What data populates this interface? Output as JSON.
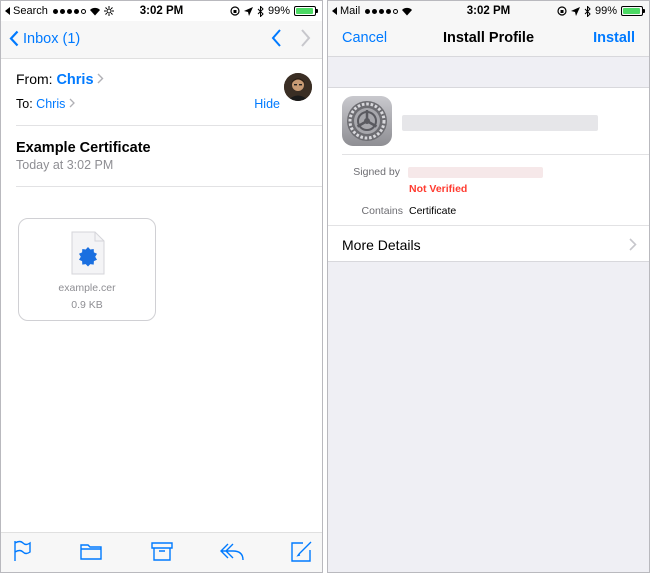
{
  "left": {
    "status": {
      "carrier": "Search",
      "time": "3:02 PM",
      "battery": "99%",
      "battery_fraction": 0.99
    },
    "nav": {
      "back_label": "Inbox (1)"
    },
    "from_label": "From:",
    "from_name": "Chris",
    "to_label": "To:",
    "to_name": "Chris",
    "hide_label": "Hide",
    "subject": "Example Certificate",
    "date": "Today at 3:02 PM",
    "attachment": {
      "filename": "example.cer",
      "size": "0.9 KB"
    },
    "toolbar": [
      "flag-icon",
      "folder-icon",
      "archive-icon",
      "reply-icon",
      "compose-icon"
    ]
  },
  "right": {
    "status": {
      "carrier": "Mail",
      "time": "3:02 PM",
      "battery": "99%",
      "battery_fraction": 0.99
    },
    "nav": {
      "cancel": "Cancel",
      "title": "Install Profile",
      "install": "Install"
    },
    "signed_by_label": "Signed by",
    "signed_by_status": "Not Verified",
    "contains_label": "Contains",
    "contains_value": "Certificate",
    "more_details": "More Details"
  },
  "colors": {
    "accent": "#007aff",
    "error": "#ff3b30",
    "battery": "#4cd964"
  }
}
